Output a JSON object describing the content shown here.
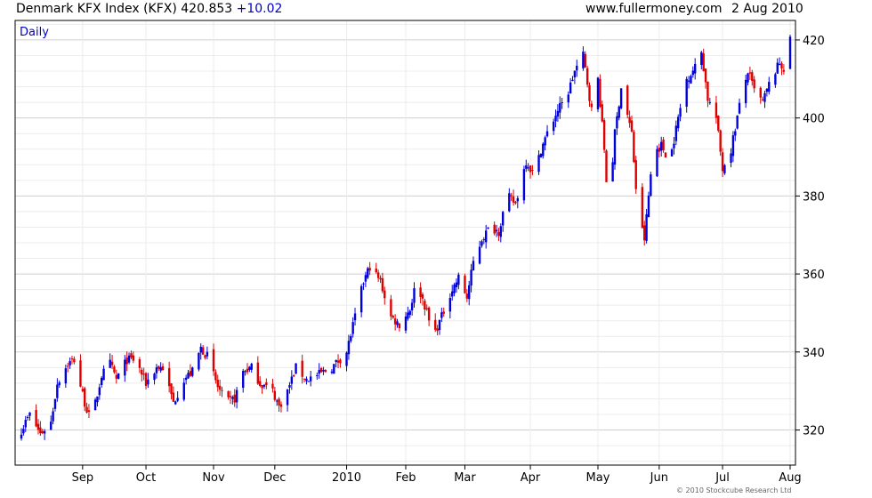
{
  "header": {
    "title": "Denmark KFX Index (KFX)",
    "last": "420.853",
    "change": "+10.02",
    "site": "www.fullermoney.com",
    "date": "2 Aug 2010"
  },
  "period_label": "Daily",
  "copyright": "© 2010 Stockcube Research Ltd",
  "colors": {
    "up": "#0000dd",
    "down": "#dd0000",
    "grid_major": "#cfcfcf",
    "grid_minor": "#ececec",
    "frame": "#000000"
  },
  "chart_data": {
    "type": "candlestick",
    "title": "Denmark KFX Index (KFX) 420.853 +10.02",
    "xlabel": "",
    "ylabel": "",
    "ylim": [
      311,
      425
    ],
    "y_ticks": [
      320,
      340,
      360,
      380,
      400,
      420
    ],
    "y_axis_side": "right",
    "grid": true,
    "x_start": "2009-08-03",
    "x_end": "2010-08-02",
    "x_ticks": [
      {
        "label": "Sep",
        "date": "2009-09-01"
      },
      {
        "label": "Oct",
        "date": "2009-10-01"
      },
      {
        "label": "Nov",
        "date": "2009-11-02"
      },
      {
        "label": "Dec",
        "date": "2009-12-01"
      },
      {
        "label": "2010",
        "date": "2010-01-04"
      },
      {
        "label": "Feb",
        "date": "2010-02-01"
      },
      {
        "label": "Mar",
        "date": "2010-03-01"
      },
      {
        "label": "Apr",
        "date": "2010-04-01"
      },
      {
        "label": "May",
        "date": "2010-05-03"
      },
      {
        "label": "Jun",
        "date": "2010-06-01"
      },
      {
        "label": "Jul",
        "date": "2010-07-01"
      },
      {
        "label": "Aug",
        "date": "2010-08-02"
      }
    ],
    "close_path": [
      [
        "2009-08-03",
        320
      ],
      [
        "2009-08-07",
        324
      ],
      [
        "2009-08-12",
        319
      ],
      [
        "2009-08-17",
        322
      ],
      [
        "2009-08-20",
        332
      ],
      [
        "2009-08-25",
        337
      ],
      [
        "2009-08-28",
        338
      ],
      [
        "2009-09-02",
        327
      ],
      [
        "2009-09-05",
        322
      ],
      [
        "2009-09-10",
        334
      ],
      [
        "2009-09-14",
        337
      ],
      [
        "2009-09-17",
        333
      ],
      [
        "2009-09-22",
        338
      ],
      [
        "2009-09-26",
        338
      ],
      [
        "2009-10-01",
        332
      ],
      [
        "2009-10-06",
        336
      ],
      [
        "2009-10-09",
        336
      ],
      [
        "2009-10-14",
        327
      ],
      [
        "2009-10-19",
        333
      ],
      [
        "2009-10-23",
        335
      ],
      [
        "2009-10-27",
        341
      ],
      [
        "2009-10-30",
        339
      ],
      [
        "2009-11-04",
        331
      ],
      [
        "2009-11-08",
        327
      ],
      [
        "2009-11-12",
        328
      ],
      [
        "2009-11-16",
        335
      ],
      [
        "2009-11-20",
        336
      ],
      [
        "2009-11-24",
        332
      ],
      [
        "2009-11-30",
        330
      ],
      [
        "2009-12-03",
        326
      ],
      [
        "2009-12-07",
        330
      ],
      [
        "2009-12-11",
        336
      ],
      [
        "2009-12-16",
        333
      ],
      [
        "2009-12-21",
        334
      ],
      [
        "2009-12-28",
        336
      ],
      [
        "2010-01-04",
        340
      ],
      [
        "2010-01-08",
        349
      ],
      [
        "2010-01-12",
        358
      ],
      [
        "2010-01-15",
        362
      ],
      [
        "2010-01-20",
        358
      ],
      [
        "2010-01-25",
        349
      ],
      [
        "2010-01-29",
        347
      ],
      [
        "2010-02-03",
        351
      ],
      [
        "2010-02-06",
        358
      ],
      [
        "2010-02-10",
        352
      ],
      [
        "2010-02-14",
        344
      ],
      [
        "2010-02-18",
        349
      ],
      [
        "2010-02-22",
        355
      ],
      [
        "2010-02-26",
        359
      ],
      [
        "2010-03-02",
        354
      ],
      [
        "2010-03-05",
        363
      ],
      [
        "2010-03-09",
        369
      ],
      [
        "2010-03-13",
        372
      ],
      [
        "2010-03-17",
        371
      ],
      [
        "2010-03-21",
        380
      ],
      [
        "2010-03-25",
        378
      ],
      [
        "2010-03-30",
        389
      ],
      [
        "2010-04-03",
        385
      ],
      [
        "2010-04-06",
        392
      ],
      [
        "2010-04-09",
        396
      ],
      [
        "2010-04-14",
        402
      ],
      [
        "2010-04-18",
        405
      ],
      [
        "2010-04-22",
        412
      ],
      [
        "2010-04-26",
        416
      ],
      [
        "2010-04-30",
        402
      ],
      [
        "2010-05-03",
        410
      ],
      [
        "2010-05-06",
        392
      ],
      [
        "2010-05-08",
        376
      ],
      [
        "2010-05-11",
        396
      ],
      [
        "2010-05-14",
        408
      ],
      [
        "2010-05-19",
        396
      ],
      [
        "2010-05-22",
        375
      ],
      [
        "2010-05-25",
        369
      ],
      [
        "2010-05-29",
        391
      ],
      [
        "2010-06-02",
        393
      ],
      [
        "2010-06-06",
        389
      ],
      [
        "2010-06-10",
        400
      ],
      [
        "2010-06-14",
        410
      ],
      [
        "2010-06-18",
        413
      ],
      [
        "2010-06-21",
        417
      ],
      [
        "2010-06-24",
        405
      ],
      [
        "2010-06-28",
        400
      ],
      [
        "2010-07-01",
        387
      ],
      [
        "2010-07-05",
        392
      ],
      [
        "2010-07-09",
        403
      ],
      [
        "2010-07-13",
        412
      ],
      [
        "2010-07-16",
        407
      ],
      [
        "2010-07-20",
        404
      ],
      [
        "2010-07-24",
        410
      ],
      [
        "2010-07-28",
        414
      ],
      [
        "2010-07-31",
        412
      ],
      [
        "2010-08-02",
        420.853
      ]
    ]
  }
}
